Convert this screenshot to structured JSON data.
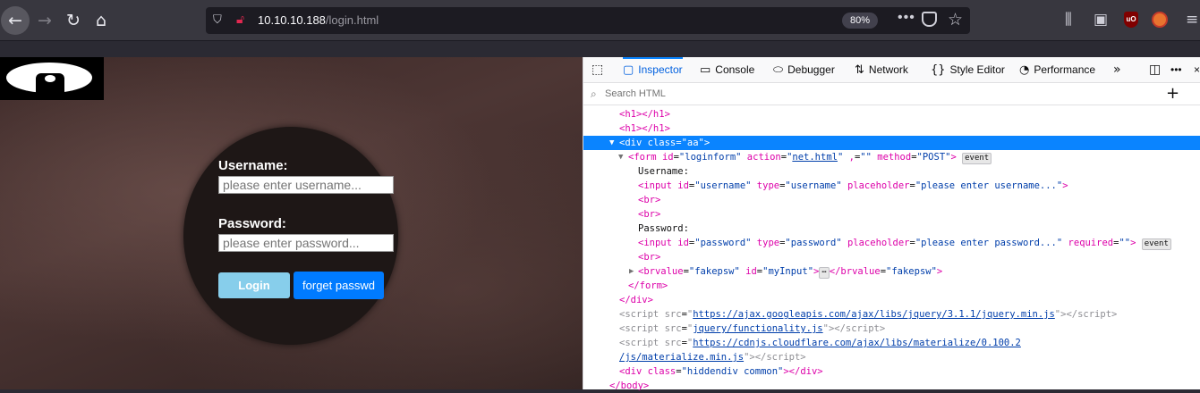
{
  "browser": {
    "url_host": "10.10.10.188",
    "url_path": "/login.html",
    "zoom": "80%"
  },
  "login": {
    "username_label": "Username:",
    "username_placeholder": "please enter username...",
    "password_label": "Password:",
    "password_placeholder": "please enter password...",
    "login_button": "Login",
    "forget_button": "forget passwd"
  },
  "devtools": {
    "tabs": [
      "Inspector",
      "Console",
      "Debugger",
      "Network",
      "Style Editor",
      "Performance"
    ],
    "search_placeholder": "Search HTML"
  }
}
